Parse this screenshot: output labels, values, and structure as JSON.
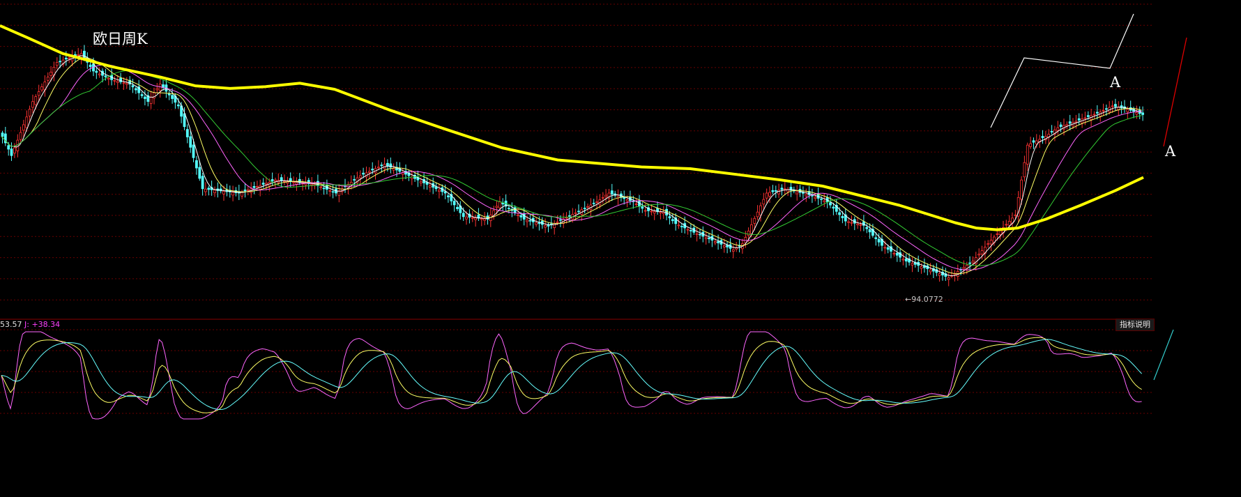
{
  "title": "欧日周K",
  "wave_labels": [
    "A",
    "A"
  ],
  "kdj_readout": {
    "prefix": "53.57",
    "j_label": "J:",
    "j_value": "+38.34"
  },
  "indicator_help": "指标说明",
  "low_annotation": "←94.0772",
  "colors": {
    "background": "#000000",
    "grid": "#6a0000",
    "up_candle": "#ff3333",
    "down_candle": "#54ffff",
    "ma5": "#ffffff",
    "ma10": "#ffff66",
    "ma20": "#ff66ff",
    "ma30": "#33cc33",
    "ma_long": "#ffff00",
    "kdj_k": "#ffffff",
    "kdj_d": "#ffff66",
    "kdj_j": "#ff66ff",
    "kdj_d2": "#66ffff"
  },
  "chart_data": [
    {
      "type": "candlestick",
      "title": "欧日周K",
      "series": [
        {
          "name": "",
          "kind": "long-moving-average",
          "values": [
            [
              0,
              123.2
            ],
            [
              40,
              121.8
            ],
            [
              90,
              120.0
            ],
            [
              160,
              118.5
            ],
            [
              230,
              117.3
            ],
            [
              280,
              116.3
            ],
            [
              330,
              116.0
            ],
            [
              380,
              116.2
            ],
            [
              430,
              116.6
            ],
            [
              480,
              115.9
            ],
            [
              560,
              113.5
            ],
            [
              640,
              111.3
            ],
            [
              720,
              109.2
            ],
            [
              800,
              107.8
            ],
            [
              860,
              107.4
            ],
            [
              920,
              107.0
            ],
            [
              990,
              106.8
            ],
            [
              1060,
              106.1
            ],
            [
              1120,
              105.5
            ],
            [
              1180,
              104.8
            ],
            [
              1240,
              103.6
            ],
            [
              1290,
              102.6
            ],
            [
              1330,
              101.6
            ],
            [
              1370,
              100.6
            ],
            [
              1400,
              100.0
            ],
            [
              1430,
              99.8
            ],
            [
              1460,
              100.0
            ],
            [
              1500,
              101.0
            ],
            [
              1550,
              102.6
            ],
            [
              1600,
              104.3
            ],
            [
              1640,
              105.8
            ]
          ]
        }
      ],
      "key_price": 94.0772
    },
    {
      "type": "line",
      "indicator": "KDJ",
      "series": [
        {
          "name": "",
          "kind": "J"
        },
        {
          "name": "",
          "kind": "K"
        },
        {
          "name": "",
          "kind": "D"
        }
      ],
      "last_values": {
        "J": 38.34
      }
    }
  ]
}
